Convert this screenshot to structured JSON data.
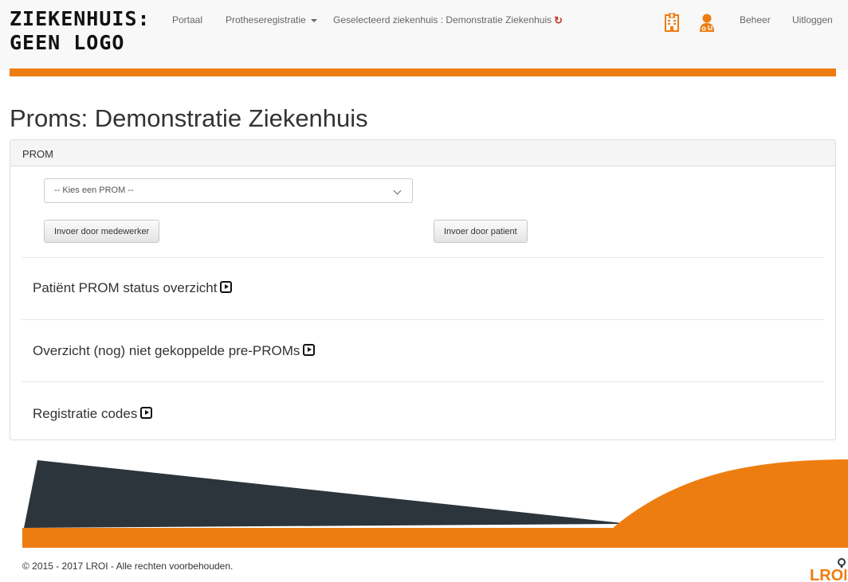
{
  "brand": {
    "line1": "ZIEKENHUIS:",
    "line2": "GEEN LOGO"
  },
  "nav": {
    "portaal": "Portaal",
    "protheseregistratie": "Protheseregistratie",
    "selected_hospital": "Geselecteerd ziekenhuis : Demonstratie Ziekenhuis",
    "beheer": "Beheer",
    "uitloggen": "Uitloggen",
    "icons": [
      "hospital-icon",
      "doctor-icon",
      "refresh-icon"
    ]
  },
  "page": {
    "title": "Proms: Demonstratie Ziekenhuis"
  },
  "panel": {
    "heading": "PROM",
    "select_value": "-- Kies een PROM --",
    "btn_medewerker": "Invoer door medewerker",
    "btn_patient": "Invoer door patient",
    "sections": [
      "Patiënt PROM status overzicht",
      "Overzicht (nog) niet gekoppelde pre-PROMs",
      "Registratie codes"
    ]
  },
  "footer": {
    "copyright": "© 2015 - 2017 LROI - Alle rechten voorbehouden.",
    "logo_text": "LROI"
  },
  "colors": {
    "accent": "#ee7d11",
    "dark": "#2c353c",
    "refresh": "#c0392b"
  }
}
